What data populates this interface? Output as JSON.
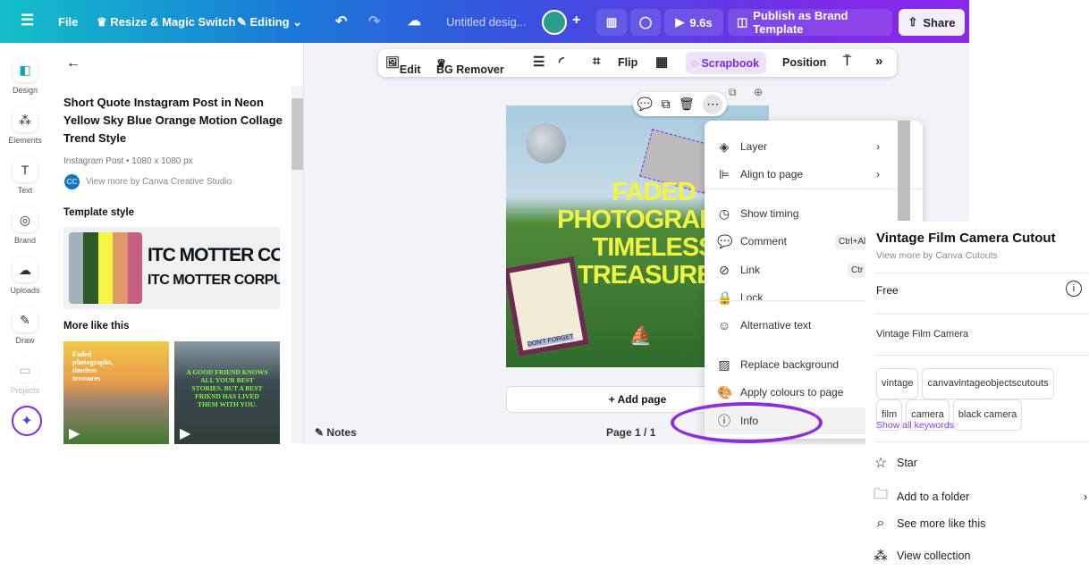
{
  "topbar": {
    "file": "File",
    "resize": "Resize & Magic Switch",
    "editing": "Editing",
    "title": "Untitled desig...",
    "timing": "9.6s",
    "publish": "Publish as Brand Template",
    "share": "Share"
  },
  "rail": [
    {
      "label": "Design",
      "icon": "design-icon"
    },
    {
      "label": "Elements",
      "icon": "elements-icon"
    },
    {
      "label": "Text",
      "icon": "text-icon"
    },
    {
      "label": "Brand",
      "icon": "brand-icon"
    },
    {
      "label": "Uploads",
      "icon": "uploads-icon"
    },
    {
      "label": "Draw",
      "icon": "draw-icon"
    },
    {
      "label": "Projects",
      "icon": "projects-icon"
    }
  ],
  "panel": {
    "title": "Short Quote Instagram Post in Neon Yellow Sky Blue Orange Motion Collage Trend Style",
    "meta": "Instagram Post • 1080 x 1080 px",
    "author_initials": "CC",
    "author": "View more by Canva Creative Studio",
    "style_heading": "Template style",
    "font1": "ITC MOTTER COR",
    "font2": "ITC MOTTER CORPUS",
    "palette": [
      "#a3b2b9",
      "#2d5a27",
      "#f4f542",
      "#e09a6a",
      "#c75f85"
    ],
    "more_heading": "More like this",
    "thumb1": "Faded photographs, timeless treasures",
    "thumb2": "A GOOD FRIEND KNOWS ALL YOUR BEST STORIES. BUT A BEST FRIEND HAS LIVED THEM WITH YOU."
  },
  "toolbar": {
    "edit": "Edit",
    "bg_remover": "BG Remover",
    "flip": "Flip",
    "scrapbook": "Scrapbook",
    "position": "Position"
  },
  "design": {
    "headline": "FADED PHOTOGRAPHS TIMELESS TREASURES",
    "sticker": "DON'T FORGET"
  },
  "canvas": {
    "add_page": "+ Add page",
    "notes": "Notes",
    "page": "Page 1 / 1"
  },
  "menu": {
    "items": [
      {
        "label": "Layer",
        "icon": "layers-icon",
        "arrow": true
      },
      {
        "label": "Align to page",
        "icon": "align-icon",
        "arrow": true
      },
      {
        "label": "Show timing",
        "icon": "clock-icon"
      },
      {
        "label": "Comment",
        "icon": "comment-icon",
        "shortcut": "Ctrl+Alt"
      },
      {
        "label": "Link",
        "icon": "link-icon",
        "shortcut": "Ctr"
      },
      {
        "label": "Lock",
        "icon": "lock-icon"
      },
      {
        "label": "Alternative text",
        "icon": "accessibility-icon"
      },
      {
        "label": "Replace background",
        "icon": "hatch-icon"
      },
      {
        "label": "Apply colours to page",
        "icon": "palette-icon"
      },
      {
        "label": "Info",
        "icon": "info-icon"
      }
    ]
  },
  "info": {
    "title": "Vintage Film Camera Cutout",
    "author": "View more by Canva Cutouts",
    "license": "Free",
    "name": "Vintage Film Camera",
    "tags": [
      "vintage",
      "canvavintageobjectscutouts",
      "film",
      "camera",
      "black camera"
    ],
    "show_all": "Show all keywords",
    "actions": [
      {
        "label": "Star",
        "icon": "star-icon"
      },
      {
        "label": "Add to a folder",
        "icon": "folder-icon"
      },
      {
        "label": "See more like this",
        "icon": "search-icon"
      },
      {
        "label": "View collection",
        "icon": "collection-icon"
      }
    ]
  },
  "colors": {
    "accent": "#7d2ae8",
    "highlight": "#8b2fd9",
    "link": "#8b3dff"
  }
}
